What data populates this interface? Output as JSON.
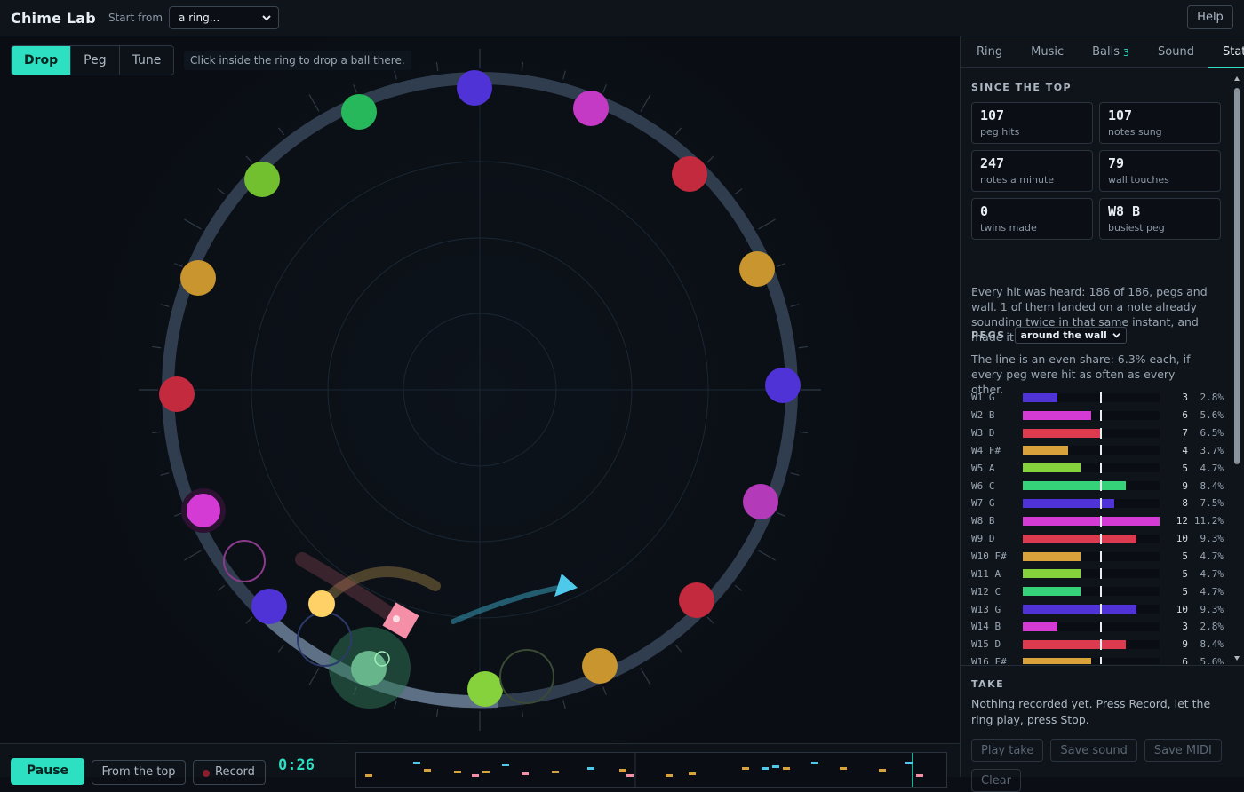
{
  "header": {
    "app_title": "Chime Lab",
    "start_label": "Start from",
    "start_value": "a ring...",
    "help_label": "Help"
  },
  "tools": {
    "items": [
      {
        "label": "Drop",
        "active": true
      },
      {
        "label": "Peg",
        "active": false
      },
      {
        "label": "Tune",
        "active": false
      }
    ],
    "hint": "Click inside the ring to drop a ball there."
  },
  "transport": {
    "pause_label": "Pause",
    "from_top_label": "From the top",
    "record_label": "Record",
    "time": "0:26"
  },
  "tabs": {
    "ring": "Ring",
    "music": "Music",
    "balls": "Balls",
    "balls_count": "3",
    "sound": "Sound",
    "stats": "Stats"
  },
  "stats": {
    "section_title": "SINCE THE TOP",
    "cards": [
      {
        "value": "107",
        "label": "peg hits"
      },
      {
        "value": "107",
        "label": "notes sung"
      },
      {
        "value": "247",
        "label": "notes a minute"
      },
      {
        "value": "79",
        "label": "wall touches"
      },
      {
        "value": "0",
        "label": "twins made"
      },
      {
        "value": "W8 B",
        "label": "busiest peg"
      }
    ],
    "summary": "Every hit was heard: 186 of 186, pegs and wall. 1 of them landed on a note already sounding twice in that same instant, and made it louder.",
    "pegs_title": "PEGS",
    "pegs_view": "around the wall",
    "pegs_note": "The line is an even share: 6.3% each, if every peg were hit as often as every other.",
    "even_share": 6.3,
    "pegs": [
      {
        "name": "W1 G",
        "count": "3",
        "pct": "2.8%",
        "share": 2.8,
        "color": "#4f33d6"
      },
      {
        "name": "W2 B",
        "count": "6",
        "pct": "5.6%",
        "share": 5.6,
        "color": "#d43ad4"
      },
      {
        "name": "W3 D",
        "count": "7",
        "pct": "6.5%",
        "share": 6.5,
        "color": "#dc3a4e"
      },
      {
        "name": "W4 F#",
        "count": "4",
        "pct": "3.7%",
        "share": 3.7,
        "color": "#d9a23a"
      },
      {
        "name": "W5 A",
        "count": "5",
        "pct": "4.7%",
        "share": 4.7,
        "color": "#86d23c"
      },
      {
        "name": "W6 C",
        "count": "9",
        "pct": "8.4%",
        "share": 8.4,
        "color": "#35d27a"
      },
      {
        "name": "W7 G",
        "count": "8",
        "pct": "7.5%",
        "share": 7.5,
        "color": "#4f33d6"
      },
      {
        "name": "W8 B",
        "count": "12",
        "pct": "11.2%",
        "share": 11.2,
        "color": "#d43ad4"
      },
      {
        "name": "W9 D",
        "count": "10",
        "pct": "9.3%",
        "share": 9.3,
        "color": "#dc3a4e"
      },
      {
        "name": "W10 F#",
        "count": "5",
        "pct": "4.7%",
        "share": 4.7,
        "color": "#d9a23a"
      },
      {
        "name": "W11 A",
        "count": "5",
        "pct": "4.7%",
        "share": 4.7,
        "color": "#86d23c"
      },
      {
        "name": "W12 C",
        "count": "5",
        "pct": "4.7%",
        "share": 4.7,
        "color": "#35d27a"
      },
      {
        "name": "W13 G",
        "count": "10",
        "pct": "9.3%",
        "share": 9.3,
        "color": "#4f33d6"
      },
      {
        "name": "W14 B",
        "count": "3",
        "pct": "2.8%",
        "share": 2.8,
        "color": "#d43ad4"
      },
      {
        "name": "W15 D",
        "count": "9",
        "pct": "8.4%",
        "share": 8.4,
        "color": "#dc3a4e"
      },
      {
        "name": "W16 F#",
        "count": "6",
        "pct": "5.6%",
        "share": 5.6,
        "color": "#d9a23a"
      }
    ]
  },
  "take": {
    "title": "TAKE",
    "message": "Nothing recorded yet. Press Record, let the ring play, press Stop.",
    "play_label": "Play take",
    "save_sound_label": "Save sound",
    "save_midi_label": "Save MIDI",
    "clear_label": "Clear"
  },
  "colors": {
    "accent": "#2ee0c2",
    "ring": "#2f3d4e"
  }
}
